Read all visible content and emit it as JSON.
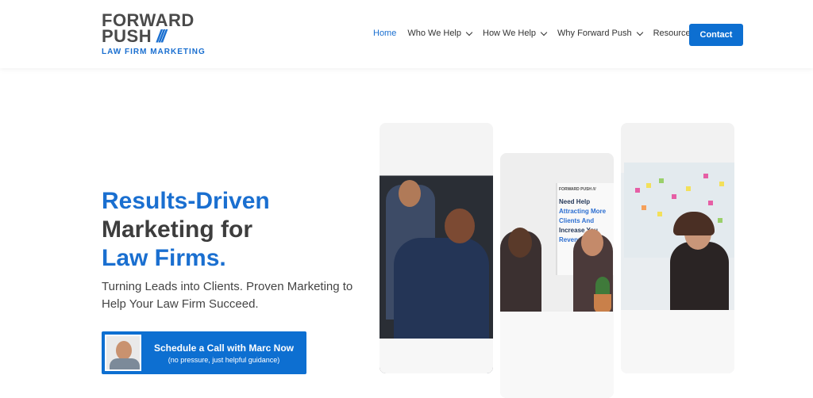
{
  "brand": {
    "line1": "FORWARD",
    "line2": "PUSH",
    "slashes": "///",
    "sub": "LAW FIRM MARKETING"
  },
  "nav": {
    "items": [
      {
        "label": "Home",
        "active": true
      },
      {
        "label": "Who We Help",
        "has_dropdown": true
      },
      {
        "label": "How We Help",
        "has_dropdown": true
      },
      {
        "label": "Why Forward Push",
        "has_dropdown": true
      },
      {
        "label": "Resources"
      }
    ],
    "contact_label": "Contact"
  },
  "hero": {
    "title_line1": "Results-Driven",
    "title_line2": "Marketing for",
    "title_line3": "Law Firms.",
    "subtitle": "Turning Leads into Clients. Proven Marketing to Help Your Law Firm Succeed.",
    "cta_main": "Schedule a Call with Marc Now",
    "cta_sub": "(no pressure, just helpful guidance)"
  },
  "banner": {
    "brand": "FORWARD PUSH ///",
    "line1": "Need Help",
    "line2": "Attracting More",
    "line3": "Clients And",
    "line4": "Increase You",
    "line5": "Revenue"
  },
  "colors": {
    "accent": "#1a6fd0",
    "button": "#0d6fd1",
    "text_dark": "#3d3d3d"
  }
}
